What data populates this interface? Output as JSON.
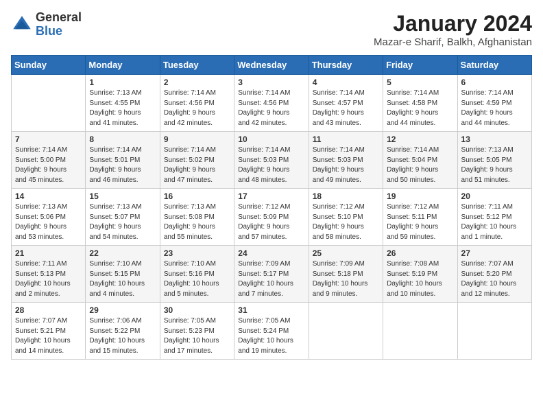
{
  "logo": {
    "line1": "General",
    "line2": "Blue"
  },
  "title": "January 2024",
  "subtitle": "Mazar-e Sharif, Balkh, Afghanistan",
  "days_of_week": [
    "Sunday",
    "Monday",
    "Tuesday",
    "Wednesday",
    "Thursday",
    "Friday",
    "Saturday"
  ],
  "weeks": [
    [
      {
        "day": "",
        "content": ""
      },
      {
        "day": "1",
        "content": "Sunrise: 7:13 AM\nSunset: 4:55 PM\nDaylight: 9 hours\nand 41 minutes."
      },
      {
        "day": "2",
        "content": "Sunrise: 7:14 AM\nSunset: 4:56 PM\nDaylight: 9 hours\nand 42 minutes."
      },
      {
        "day": "3",
        "content": "Sunrise: 7:14 AM\nSunset: 4:56 PM\nDaylight: 9 hours\nand 42 minutes."
      },
      {
        "day": "4",
        "content": "Sunrise: 7:14 AM\nSunset: 4:57 PM\nDaylight: 9 hours\nand 43 minutes."
      },
      {
        "day": "5",
        "content": "Sunrise: 7:14 AM\nSunset: 4:58 PM\nDaylight: 9 hours\nand 44 minutes."
      },
      {
        "day": "6",
        "content": "Sunrise: 7:14 AM\nSunset: 4:59 PM\nDaylight: 9 hours\nand 44 minutes."
      }
    ],
    [
      {
        "day": "7",
        "content": "Sunrise: 7:14 AM\nSunset: 5:00 PM\nDaylight: 9 hours\nand 45 minutes."
      },
      {
        "day": "8",
        "content": "Sunrise: 7:14 AM\nSunset: 5:01 PM\nDaylight: 9 hours\nand 46 minutes."
      },
      {
        "day": "9",
        "content": "Sunrise: 7:14 AM\nSunset: 5:02 PM\nDaylight: 9 hours\nand 47 minutes."
      },
      {
        "day": "10",
        "content": "Sunrise: 7:14 AM\nSunset: 5:03 PM\nDaylight: 9 hours\nand 48 minutes."
      },
      {
        "day": "11",
        "content": "Sunrise: 7:14 AM\nSunset: 5:03 PM\nDaylight: 9 hours\nand 49 minutes."
      },
      {
        "day": "12",
        "content": "Sunrise: 7:14 AM\nSunset: 5:04 PM\nDaylight: 9 hours\nand 50 minutes."
      },
      {
        "day": "13",
        "content": "Sunrise: 7:13 AM\nSunset: 5:05 PM\nDaylight: 9 hours\nand 51 minutes."
      }
    ],
    [
      {
        "day": "14",
        "content": "Sunrise: 7:13 AM\nSunset: 5:06 PM\nDaylight: 9 hours\nand 53 minutes."
      },
      {
        "day": "15",
        "content": "Sunrise: 7:13 AM\nSunset: 5:07 PM\nDaylight: 9 hours\nand 54 minutes."
      },
      {
        "day": "16",
        "content": "Sunrise: 7:13 AM\nSunset: 5:08 PM\nDaylight: 9 hours\nand 55 minutes."
      },
      {
        "day": "17",
        "content": "Sunrise: 7:12 AM\nSunset: 5:09 PM\nDaylight: 9 hours\nand 57 minutes."
      },
      {
        "day": "18",
        "content": "Sunrise: 7:12 AM\nSunset: 5:10 PM\nDaylight: 9 hours\nand 58 minutes."
      },
      {
        "day": "19",
        "content": "Sunrise: 7:12 AM\nSunset: 5:11 PM\nDaylight: 9 hours\nand 59 minutes."
      },
      {
        "day": "20",
        "content": "Sunrise: 7:11 AM\nSunset: 5:12 PM\nDaylight: 10 hours\nand 1 minute."
      }
    ],
    [
      {
        "day": "21",
        "content": "Sunrise: 7:11 AM\nSunset: 5:13 PM\nDaylight: 10 hours\nand 2 minutes."
      },
      {
        "day": "22",
        "content": "Sunrise: 7:10 AM\nSunset: 5:15 PM\nDaylight: 10 hours\nand 4 minutes."
      },
      {
        "day": "23",
        "content": "Sunrise: 7:10 AM\nSunset: 5:16 PM\nDaylight: 10 hours\nand 5 minutes."
      },
      {
        "day": "24",
        "content": "Sunrise: 7:09 AM\nSunset: 5:17 PM\nDaylight: 10 hours\nand 7 minutes."
      },
      {
        "day": "25",
        "content": "Sunrise: 7:09 AM\nSunset: 5:18 PM\nDaylight: 10 hours\nand 9 minutes."
      },
      {
        "day": "26",
        "content": "Sunrise: 7:08 AM\nSunset: 5:19 PM\nDaylight: 10 hours\nand 10 minutes."
      },
      {
        "day": "27",
        "content": "Sunrise: 7:07 AM\nSunset: 5:20 PM\nDaylight: 10 hours\nand 12 minutes."
      }
    ],
    [
      {
        "day": "28",
        "content": "Sunrise: 7:07 AM\nSunset: 5:21 PM\nDaylight: 10 hours\nand 14 minutes."
      },
      {
        "day": "29",
        "content": "Sunrise: 7:06 AM\nSunset: 5:22 PM\nDaylight: 10 hours\nand 15 minutes."
      },
      {
        "day": "30",
        "content": "Sunrise: 7:05 AM\nSunset: 5:23 PM\nDaylight: 10 hours\nand 17 minutes."
      },
      {
        "day": "31",
        "content": "Sunrise: 7:05 AM\nSunset: 5:24 PM\nDaylight: 10 hours\nand 19 minutes."
      },
      {
        "day": "",
        "content": ""
      },
      {
        "day": "",
        "content": ""
      },
      {
        "day": "",
        "content": ""
      }
    ]
  ]
}
